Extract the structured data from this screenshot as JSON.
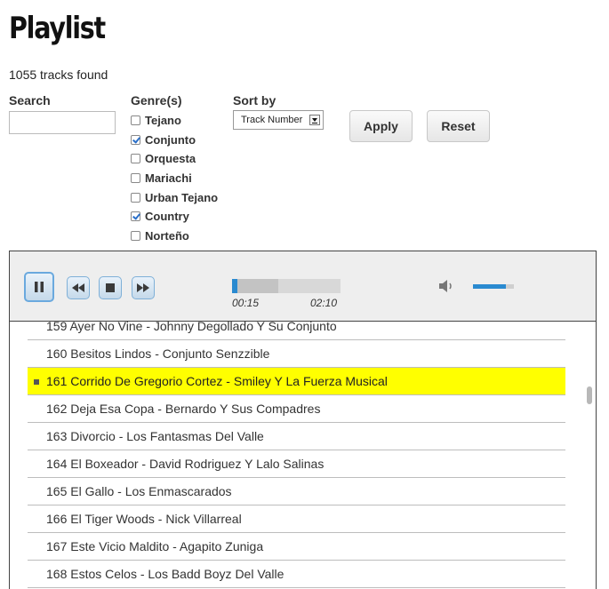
{
  "page": {
    "title": "Playlist",
    "track_count": "1055 tracks found"
  },
  "filters": {
    "search_label": "Search",
    "search_value": "",
    "genre_label": "Genre(s)",
    "genres": [
      {
        "label": "Tejano",
        "checked": false
      },
      {
        "label": "Conjunto",
        "checked": true
      },
      {
        "label": "Orquesta",
        "checked": false
      },
      {
        "label": "Mariachi",
        "checked": false
      },
      {
        "label": "Urban Tejano",
        "checked": false
      },
      {
        "label": "Country",
        "checked": true
      },
      {
        "label": "Norteño",
        "checked": false
      }
    ],
    "sort_label": "Sort by",
    "sort_value": "Track Number",
    "apply_label": "Apply",
    "reset_label": "Reset"
  },
  "player": {
    "state": "playing",
    "controls": [
      "pause-icon",
      "previous-icon",
      "stop-icon",
      "next-icon"
    ],
    "current_time": "00:15",
    "duration": "02:10",
    "seek_fraction": 0.43,
    "volume_fraction": 0.8,
    "accent_color": "#2a8ad0"
  },
  "playlist": {
    "highlight_color": "#ffff00",
    "tracks": [
      {
        "label": "159 Ayer No Vine - Johnny Degollado Y Su Conjunto",
        "active": false
      },
      {
        "label": "160 Besitos Lindos - Conjunto Senzzible",
        "active": false
      },
      {
        "label": "161 Corrido De Gregorio Cortez - Smiley Y La Fuerza Musical",
        "active": true
      },
      {
        "label": "162 Deja Esa Copa - Bernardo Y Sus Compadres",
        "active": false
      },
      {
        "label": "163 Divorcio - Los Fantasmas Del Valle",
        "active": false
      },
      {
        "label": "164 El Boxeador - David Rodriguez Y Lalo Salinas",
        "active": false
      },
      {
        "label": "165 El Gallo - Los Enmascarados",
        "active": false
      },
      {
        "label": "166 El Tiger Woods - Nick Villarreal",
        "active": false
      },
      {
        "label": "167 Este Vicio Maldito - Agapito Zuniga",
        "active": false
      },
      {
        "label": "168 Estos Celos - Los Badd Boyz Del Valle",
        "active": false
      }
    ]
  }
}
